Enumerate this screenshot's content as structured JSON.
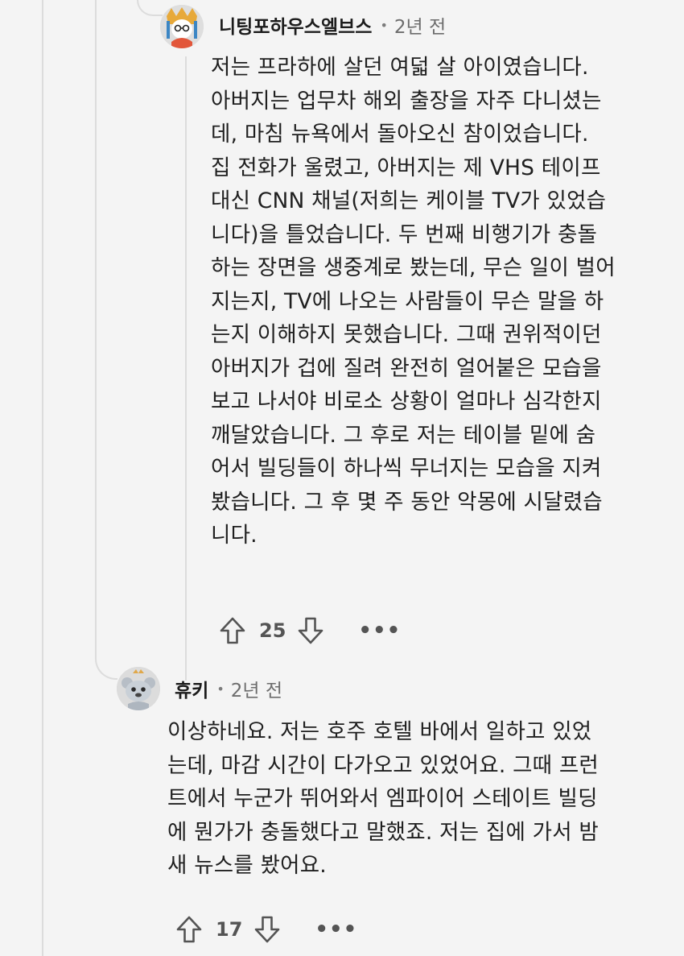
{
  "comments": [
    {
      "author": "니팅포하우스엘브스",
      "separator": "•",
      "time": "2년 전",
      "lines": [
        "저는 프라하에 살던 여덟 살 아이였습니다.",
        "아버지는 업무차 해외 출장을 자주 다니셨는",
        "데, 마침 뉴욕에서 돌아오신 참이었습니다.",
        "집 전화가 울렸고, 아버지는 제 VHS 테이프",
        "대신 CNN 채널(저희는 케이블 TV가 있었습",
        "니다)을 틀었습니다. 두 번째 비행기가 충돌",
        "하는 장면을 생중계로 봤는데, 무슨 일이 벌어",
        "지는지, TV에 나오는 사람들이 무슨 말을 하",
        "는지 이해하지 못했습니다. 그때 권위적이던",
        "아버지가 겁에 질려 완전히 얼어붙은 모습을",
        "보고 나서야 비로소 상황이 얼마나 심각한지",
        "깨달았습니다. 그 후로 저는 테이블 밑에 숨",
        "어서 빌딩들이 하나씩 무너지는 모습을 지켜",
        "봤습니다. 그 후 몇 주 동안 악몽에 시달렸습",
        "니다."
      ],
      "score": "25",
      "more": "•••",
      "avatar_icon": "user-avatar-knitting"
    },
    {
      "author": "휴키",
      "separator": "•",
      "time": "2년 전",
      "lines": [
        "이상하네요. 저는 호주 호텔 바에서 일하고 있었",
        "는데, 마감 시간이 다가오고 있었어요. 그때 프런",
        "트에서 누군가 뛰어와서 엠파이어 스테이트 빌딩",
        "에 뭔가가 충돌했다고 말했죠. 저는 집에 가서 밤",
        "새 뉴스를 봤어요."
      ],
      "score": "17",
      "more": "•••",
      "avatar_icon": "user-avatar-snoo"
    }
  ],
  "colors": {
    "background": "#f4f4f4",
    "thread_line": "#dcdcdc",
    "text": "#1f1f1f",
    "meta": "#6d6d6d",
    "icon": "#545454"
  }
}
